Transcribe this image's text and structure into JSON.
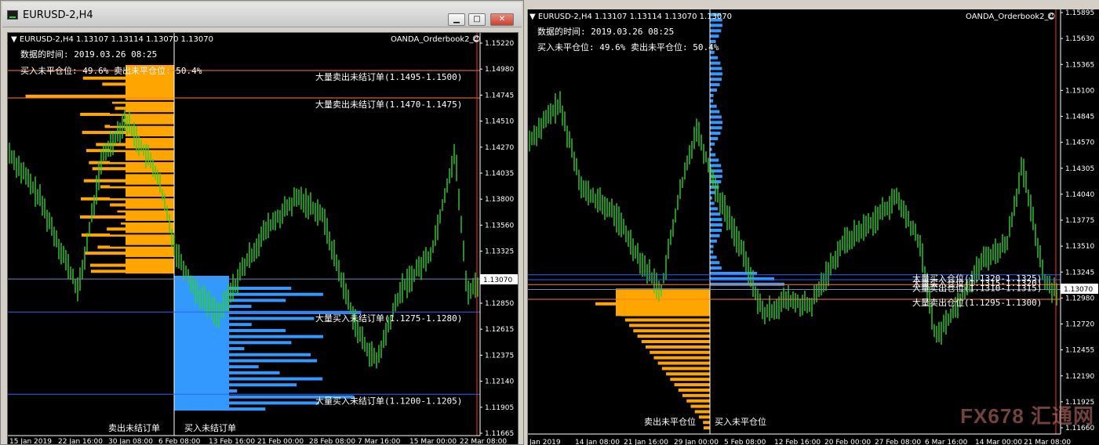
{
  "left_window": {
    "title": "EURUSD-2,H4",
    "buttons": {
      "minimize": "▁",
      "maximize": "□",
      "close": "✕"
    },
    "chart": {
      "header": "▼ EURUSD-2,H4  1.13107 1.13114 1.13070 1.13070",
      "indicator": "OANDA_Orderbook2_C",
      "data_time": "数据的时间:  2019.03.26 08:25",
      "positions": "买入未平仓位: 49.6%  卖出未平仓位: 50.4%",
      "levels": [
        {
          "text": "大量卖出未结订单(1.1495-1.1500)",
          "price": 1.1497
        },
        {
          "text": "大量卖出未结订单(1.1470-1.1475)",
          "price": 1.1472
        },
        {
          "text": "大量买入未结订单(1.1275-1.1280)",
          "price": 1.1277
        },
        {
          "text": "大量买入未结订单(1.1200-1.1205)",
          "price": 1.1202
        }
      ],
      "bottom_labels": {
        "sell": "卖出未结订单",
        "buy": "买入未结订单"
      },
      "current_price": "1.13070",
      "price_ticks": [
        "1.15220",
        "1.14980",
        "1.14745",
        "1.14510",
        "1.14270",
        "1.14035",
        "1.13800",
        "1.13560",
        "1.13325",
        "1.13070",
        "1.12850",
        "1.12615",
        "1.12375",
        "1.12140",
        "1.11905",
        "1.11665"
      ],
      "time_ticks": [
        "15 Jan 2019",
        "22 Jan 16:00",
        "30 Jan 08:00",
        "6 Feb 08:00",
        "13 Feb 16:00",
        "21 Feb 00:00",
        "28 Feb 08:00",
        "7 Mar 16:00",
        "15 Mar 00:00",
        "22 Mar 08:00"
      ]
    }
  },
  "right_window": {
    "chart": {
      "header": "▼ EURUSD-2,H4  1.13107 1.13114 1.13070 1.13070",
      "indicator": "OANDA_Orderbook2_C",
      "data_time": "数据的时间:  2019.03.26 08:25",
      "positions": "买入未平仓位: 49.6%  卖出未平仓位: 50.4%",
      "levels": [
        {
          "text": "大量买入仓位(1.1320-1.1325)",
          "price": 1.1322
        },
        {
          "text": "大量卖出仓位(1.1310-1.1315)",
          "price": 1.1312
        },
        {
          "text": "大量买入仓位(1.1315-1.1320)",
          "price": 1.1317
        },
        {
          "text": "大量卖出仓位(1.1295-1.1300)",
          "price": 1.1297
        }
      ],
      "bottom_labels": {
        "sell": "卖出未平仓位",
        "buy": "买入未平仓位"
      },
      "current_price": "1.13070",
      "price_ticks": [
        "1.15895",
        "1.15630",
        "1.15365",
        "1.15100",
        "1.14845",
        "1.14570",
        "1.14305",
        "1.14040",
        "1.13775",
        "1.13510",
        "1.13245",
        "1.12980",
        "1.12720",
        "1.12455",
        "1.12190",
        "1.11925",
        "1.11660"
      ],
      "time_ticks": [
        "Jan 2019",
        "14 Jan 08:00",
        "21 Jan 16:00",
        "29 Jan 00:00",
        "5 Feb 08:00",
        "12 Feb 16:00",
        "20 Feb 00:00",
        "27 Feb 08:00",
        "6 Mar 16:00",
        "14 Mar 00:00",
        "21 Mar 08:00"
      ]
    },
    "watermark": "FX678 汇通网"
  },
  "colors": {
    "candle": "#2fd12f",
    "sell": "#ffa500",
    "buy": "#3399ff",
    "background": "#000000",
    "red_line": "#ff3030"
  }
}
